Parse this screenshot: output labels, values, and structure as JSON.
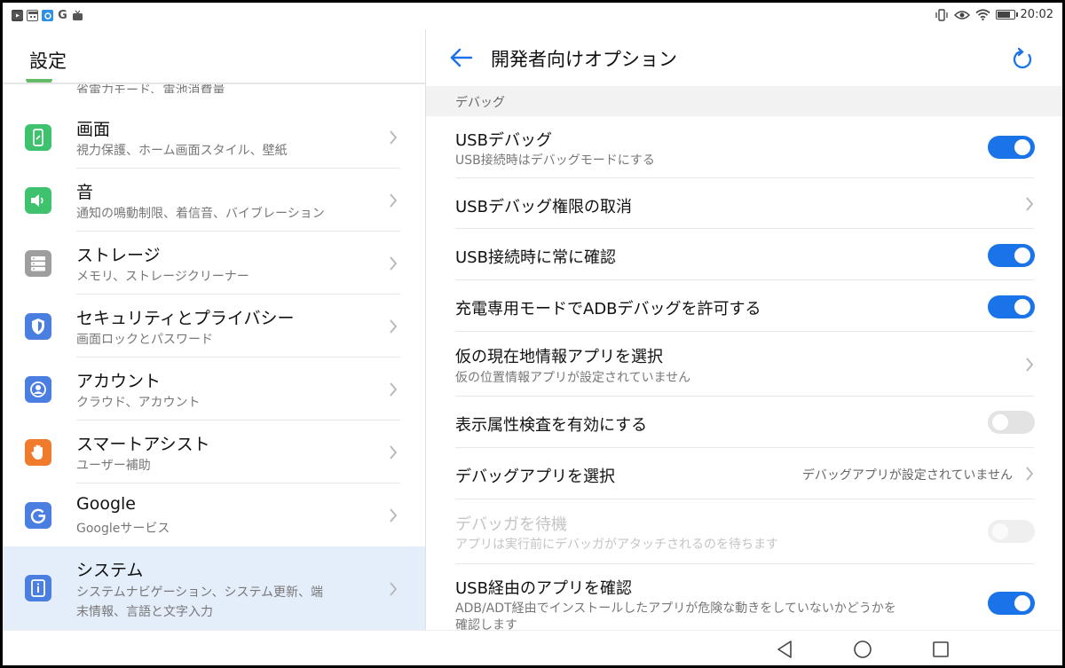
{
  "status_bar": {
    "time": "20:02",
    "battery_level": 0.7,
    "left_icons": [
      "youtube-icon",
      "calendar-icon",
      "app-icon",
      "google-icon",
      "tv-icon"
    ],
    "right_icons": [
      "vibrate-icon",
      "eye-comfort-icon",
      "wifi-icon",
      "battery-icon"
    ]
  },
  "left_pane": {
    "title": "設定",
    "clipped_item_subtitle": "省電力モード、電池消費量",
    "items": [
      {
        "label": "画面",
        "subtitle": "視力保護、ホーム画面スタイル、壁紙",
        "icon": "display-icon",
        "color": "#3ec26e"
      },
      {
        "label": "音",
        "subtitle": "通知の鳴動制限、着信音、バイブレーション",
        "icon": "sound-icon",
        "color": "#3ec26e"
      },
      {
        "label": "ストレージ",
        "subtitle": "メモリ、ストレージクリーナー",
        "icon": "storage-icon",
        "color": "#9e9e9e"
      },
      {
        "label": "セキュリティとプライバシー",
        "subtitle": "画面ロックとパスワード",
        "icon": "shield-icon",
        "color": "#4a7ee0"
      },
      {
        "label": "アカウント",
        "subtitle": "クラウド、アカウント",
        "icon": "account-icon",
        "color": "#4a7ee0"
      },
      {
        "label": "スマートアシスト",
        "subtitle": "ユーザー補助",
        "icon": "hand-icon",
        "color": "#f07b2c"
      },
      {
        "label": "Google",
        "subtitle": "Googleサービス",
        "icon": "google-icon",
        "color": "#4a7ee0"
      },
      {
        "label": "システム",
        "subtitle_line1": "システムナビゲーション、システム更新、端",
        "subtitle_line2": "末情報、言語と文字入力",
        "icon": "info-icon",
        "color": "#4a7ee0",
        "selected": true
      }
    ]
  },
  "right_pane": {
    "title": "開発者向けオプション",
    "section": "デバッグ",
    "accent": "#1a73e8",
    "items": [
      {
        "label": "USBデバッグ",
        "subtitle": "USB接続時はデバッグモードにする",
        "control": "toggle",
        "on": true
      },
      {
        "label": "USBデバッグ権限の取消",
        "control": "chevron"
      },
      {
        "label": "USB接続時に常に確認",
        "control": "toggle",
        "on": true
      },
      {
        "label": "充電専用モードでADBデバッグを許可する",
        "control": "toggle",
        "on": true
      },
      {
        "label": "仮の現在地情報アプリを選択",
        "subtitle": "仮の位置情報アプリが設定されていません",
        "control": "chevron"
      },
      {
        "label": "表示属性検査を有効にする",
        "control": "toggle",
        "on": false
      },
      {
        "label": "デバッグアプリを選択",
        "value": "デバッグアプリが設定されていません",
        "control": "chevron"
      },
      {
        "label": "デバッガを待機",
        "subtitle": "アプリは実行前にデバッガがアタッチされるのを待ちます",
        "control": "toggle",
        "on": false,
        "disabled": true
      },
      {
        "label": "USB経由のアプリを確認",
        "subtitle_line1": "ADB/ADT経由でインストールしたアプリが危険な動きをしていないかどうかを",
        "subtitle_line2": "確認します",
        "control": "toggle",
        "on": true
      }
    ]
  },
  "nav_bar": {
    "buttons": [
      "back-icon",
      "home-icon",
      "recents-icon"
    ]
  }
}
